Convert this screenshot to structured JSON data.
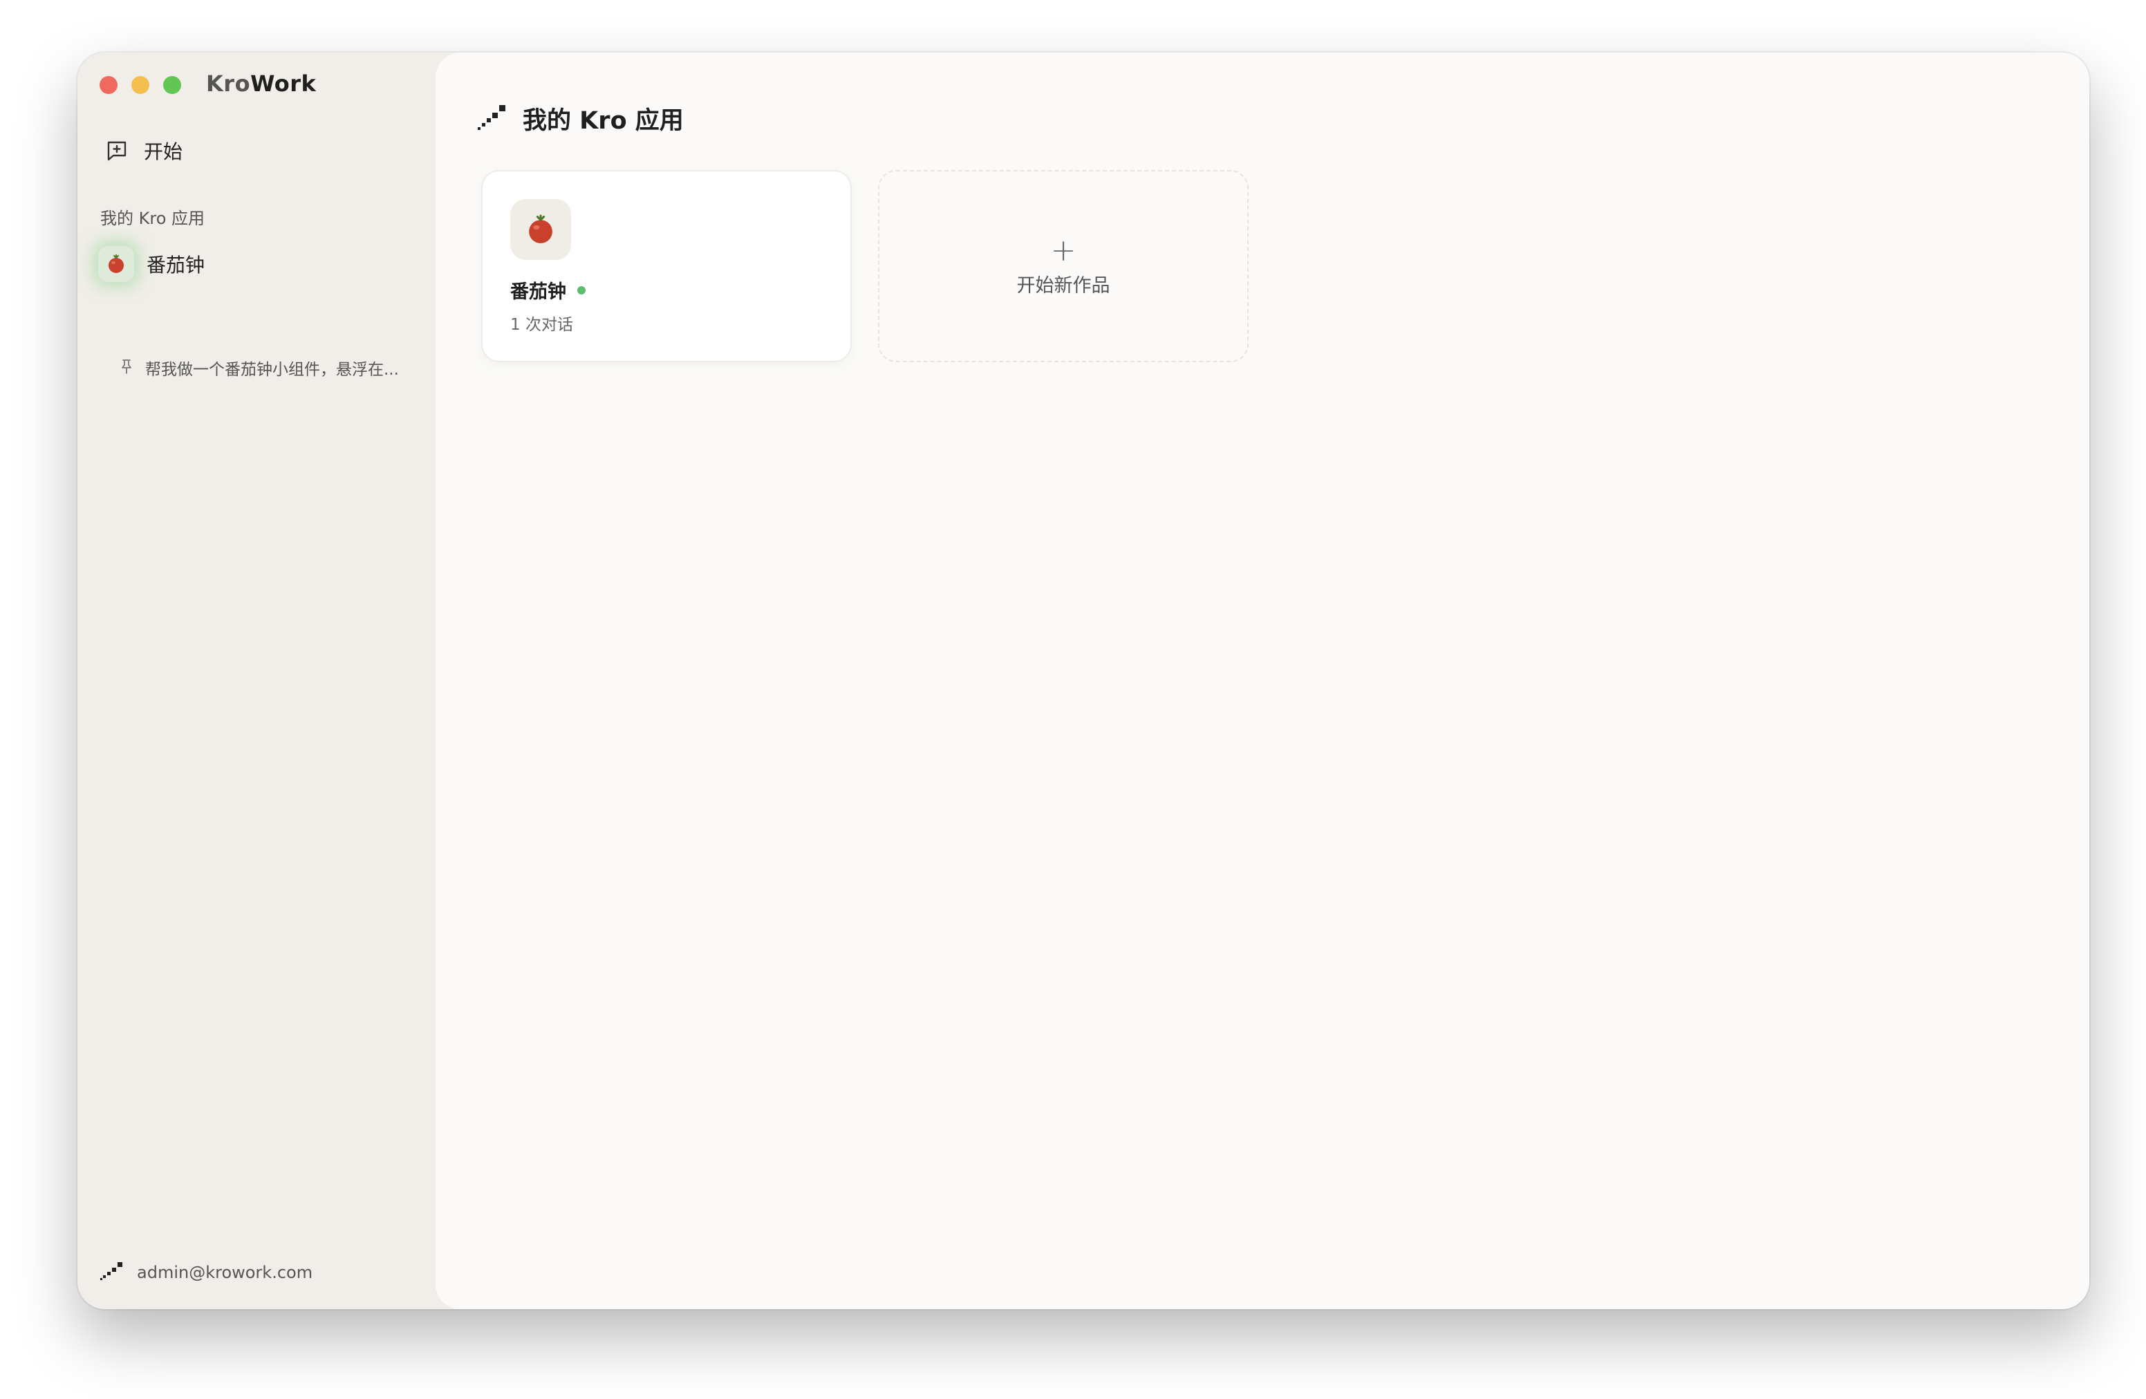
{
  "app": {
    "title_part1": "Kro",
    "title_part2": "Work"
  },
  "colors": {
    "close": "#ee6a5f",
    "minimize": "#f5bf4f",
    "maximize": "#62c554",
    "status_active": "#5cbd6c"
  },
  "sidebar": {
    "start_label": "开始",
    "start_icon": "new-chat-icon",
    "section_label": "我的 Kro 应用",
    "apps": [
      {
        "label": "番茄钟",
        "icon": "tomato-icon",
        "selected": true
      }
    ],
    "chats": [
      {
        "label": "帮我做一个番茄钟小组件，悬浮在...",
        "icon": "pin-icon"
      }
    ],
    "user_email": "admin@krowork.com"
  },
  "main": {
    "title": "我的 Kro 应用",
    "cards": [
      {
        "name": "番茄钟",
        "count": "1 次对话",
        "status": "active",
        "icon": "tomato-icon"
      }
    ],
    "new_card_label": "开始新作品",
    "new_card_icon": "plus-icon"
  }
}
